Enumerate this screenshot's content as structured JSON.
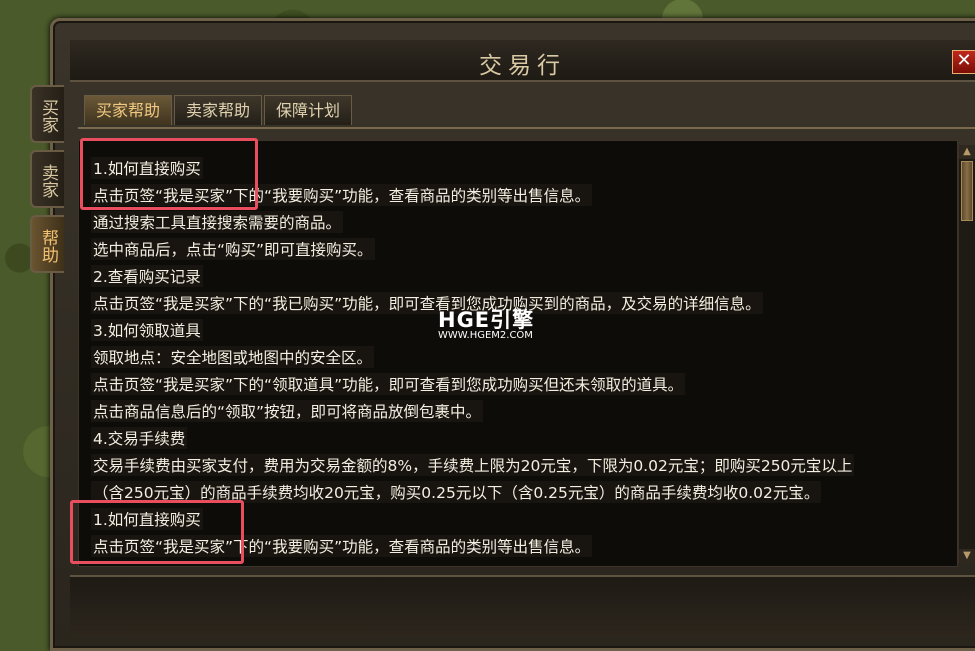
{
  "window": {
    "title": "交易行",
    "close_label": "✕"
  },
  "side_tabs": [
    {
      "label": "买家",
      "active": false
    },
    {
      "label": "卖家",
      "active": false
    },
    {
      "label": "帮助",
      "active": true
    }
  ],
  "tabs": [
    {
      "label": "买家帮助",
      "active": true
    },
    {
      "label": "卖家帮助",
      "active": false
    },
    {
      "label": "保障计划",
      "active": false
    }
  ],
  "content": {
    "lines": [
      "1.如何直接购买",
      "点击页签“我是买家”下的“我要购买”功能，查看商品的类别等出售信息。",
      "通过搜索工具直接搜索需要的商品。",
      "选中商品后，点击“购买”即可直接购买。",
      "2.查看购买记录",
      "点击页签“我是买家”下的“我已购买”功能，即可查看到您成功购买到的商品，及交易的详细信息。",
      "3.如何领取道具",
      "领取地点：安全地图或地图中的安全区。",
      "点击页签“我是买家”下的“领取道具”功能，即可查看到您成功购买但还未领取的道具。",
      "点击商品信息后的“领取”按钮，即可将商品放倒包裹中。",
      "4.交易手续费",
      "交易手续费由买家支付，费用为交易金额的8%，手续费上限为20元宝，下限为0.02元宝；即购买250元宝以上",
      "（含250元宝）的商品手续费均收20元宝，购买0.25元以下（含0.25元宝）的商品手续费均收0.02元宝。",
      "1.如何直接购买",
      "点击页签“我是买家”下的“我要购买”功能，查看商品的类别等出售信息。"
    ]
  },
  "watermark": {
    "logo": "HGE引擎",
    "url": "WWW.HGEM2.COM"
  },
  "colors": {
    "highlight": "#e84e5e",
    "active_tab": "#f0c880",
    "text": "#f4efe2"
  }
}
